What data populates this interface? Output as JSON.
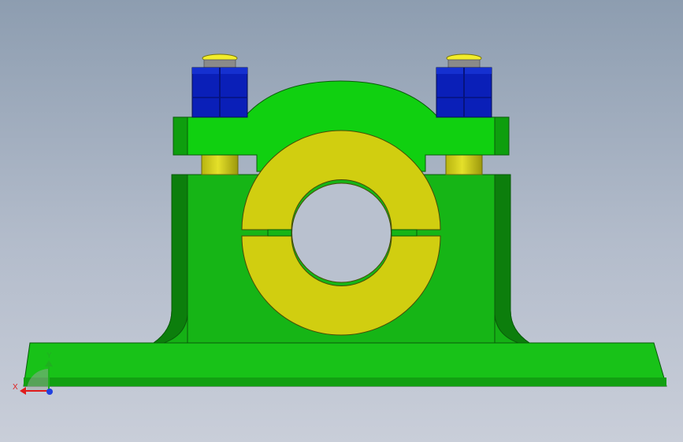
{
  "scene": {
    "description_colors": {
      "housing": "#19cc19",
      "housing_dark": "#0e8e0e",
      "cap": "#11d411",
      "bushing": "#d0cd10",
      "nut": "#0a1fb8",
      "nut_dark": "#06137e",
      "washer": "#eee92a"
    }
  },
  "triad": {
    "x_label": "X",
    "y_label": "Y",
    "x_color": "#e01c1c",
    "y_color": "#20b020",
    "z_color": "#2040e0"
  }
}
